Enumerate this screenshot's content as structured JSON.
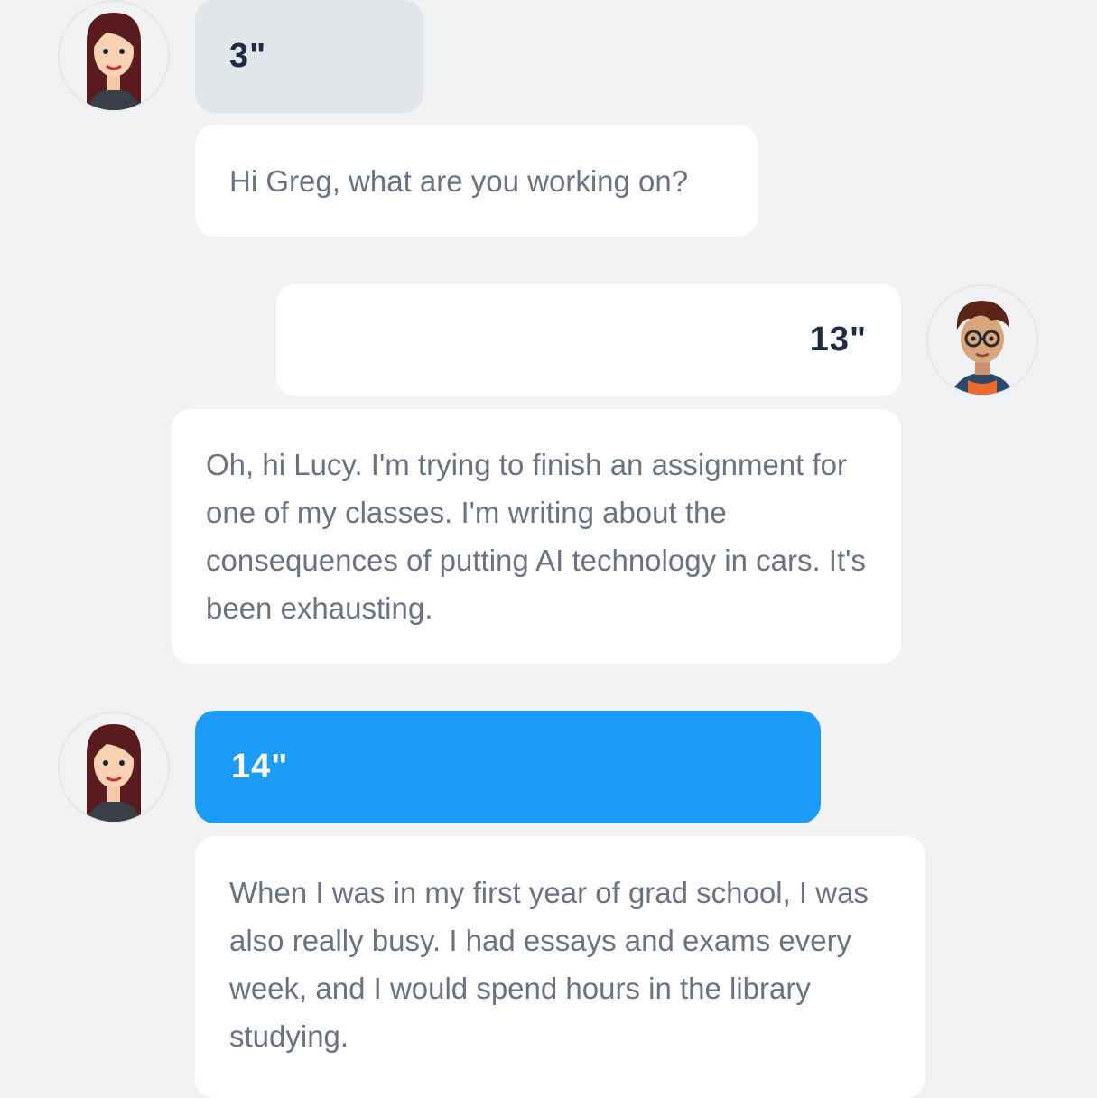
{
  "conversation": [
    {
      "speaker": "Lucy",
      "audio_label": "3\"",
      "text": "Hi Greg, what are you working on?"
    },
    {
      "speaker": "Greg",
      "audio_label": "13\"",
      "text": "Oh, hi Lucy. I'm trying to finish an assignment for one of my classes. I'm writing about the consequences of putting AI technology in cars. It's been exhausting."
    },
    {
      "speaker": "Lucy",
      "audio_label": "14\"",
      "text": "When I was in my first year of grad school, I was also really busy. I had essays and exams every week, and I would spend hours in the library studying."
    }
  ],
  "icons": {
    "lucy_avatar": "female-avatar-icon",
    "greg_avatar": "male-avatar-icon"
  },
  "colors": {
    "background": "#f1f2f4",
    "audio_grey": "#e2e5ea",
    "audio_active": "#1c9cf6",
    "text_dark": "#1f2a44",
    "text_muted": "#6b7280"
  }
}
